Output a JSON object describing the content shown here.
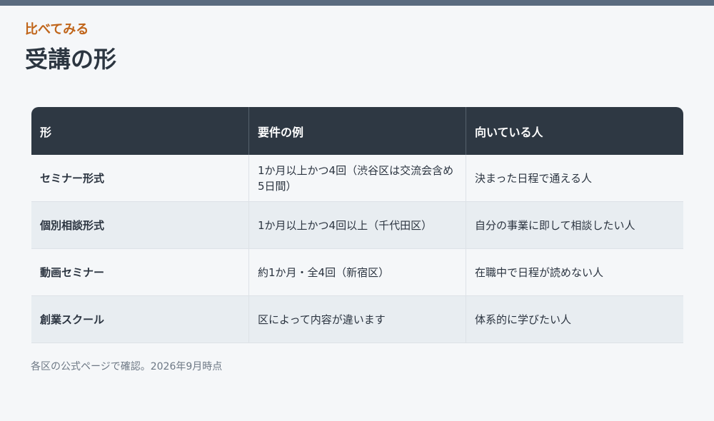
{
  "header": {
    "eyebrow": "比べてみる",
    "title": "受講の形"
  },
  "table": {
    "columns": [
      "形",
      "要件の例",
      "向いている人"
    ],
    "rows": [
      [
        "セミナー形式",
        "1か月以上かつ4回（渋谷区は交流会含め5日間）",
        "決まった日程で通える人"
      ],
      [
        "個別相談形式",
        "1か月以上かつ4回以上（千代田区）",
        "自分の事業に即して相談したい人"
      ],
      [
        "動画セミナー",
        "約1か月・全4回（新宿区）",
        "在職中で日程が読めない人"
      ],
      [
        "創業スクール",
        "区によって内容が違います",
        "体系的に学びたい人"
      ]
    ]
  },
  "footnote": "各区の公式ページで確認。2026年9月時点",
  "colors": {
    "accent": "#c0651a",
    "header_bg": "#2e3843",
    "top_bar": "#5a6b7f",
    "row_alt": "#e8edf1"
  }
}
